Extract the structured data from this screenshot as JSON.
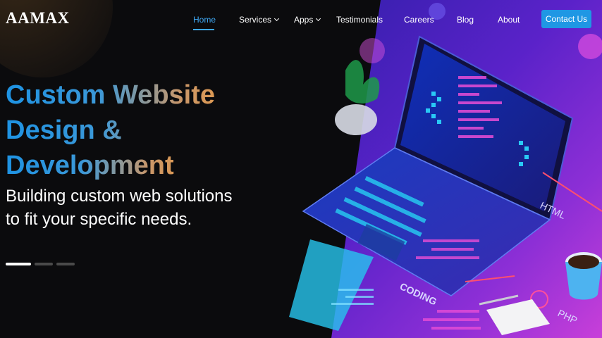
{
  "brand": {
    "logo_text": "AAMAX",
    "accent": "#3fa9f5",
    "logo_mark_color": "#2a8fd8"
  },
  "nav": {
    "items": [
      {
        "label": "Home",
        "active": true
      },
      {
        "label": "Services",
        "dropdown": true
      },
      {
        "label": "Apps",
        "dropdown": true
      },
      {
        "label": "Testimonials"
      },
      {
        "label": "Careers"
      },
      {
        "label": "Blog"
      },
      {
        "label": "About"
      }
    ],
    "contact_label": "Contact Us"
  },
  "hero": {
    "headline": [
      "Custom Website",
      "Design &",
      "Development"
    ],
    "subtitle": "Building custom web solutions to fit your specific needs.",
    "slides": {
      "count": 3,
      "active": 1
    },
    "art_labels": [
      "HTML",
      "CODING",
      "PHP"
    ]
  },
  "colors": {
    "button": "#1f97e4",
    "gradient_start": "#1e93e3",
    "gradient_end": "#e99a44"
  }
}
